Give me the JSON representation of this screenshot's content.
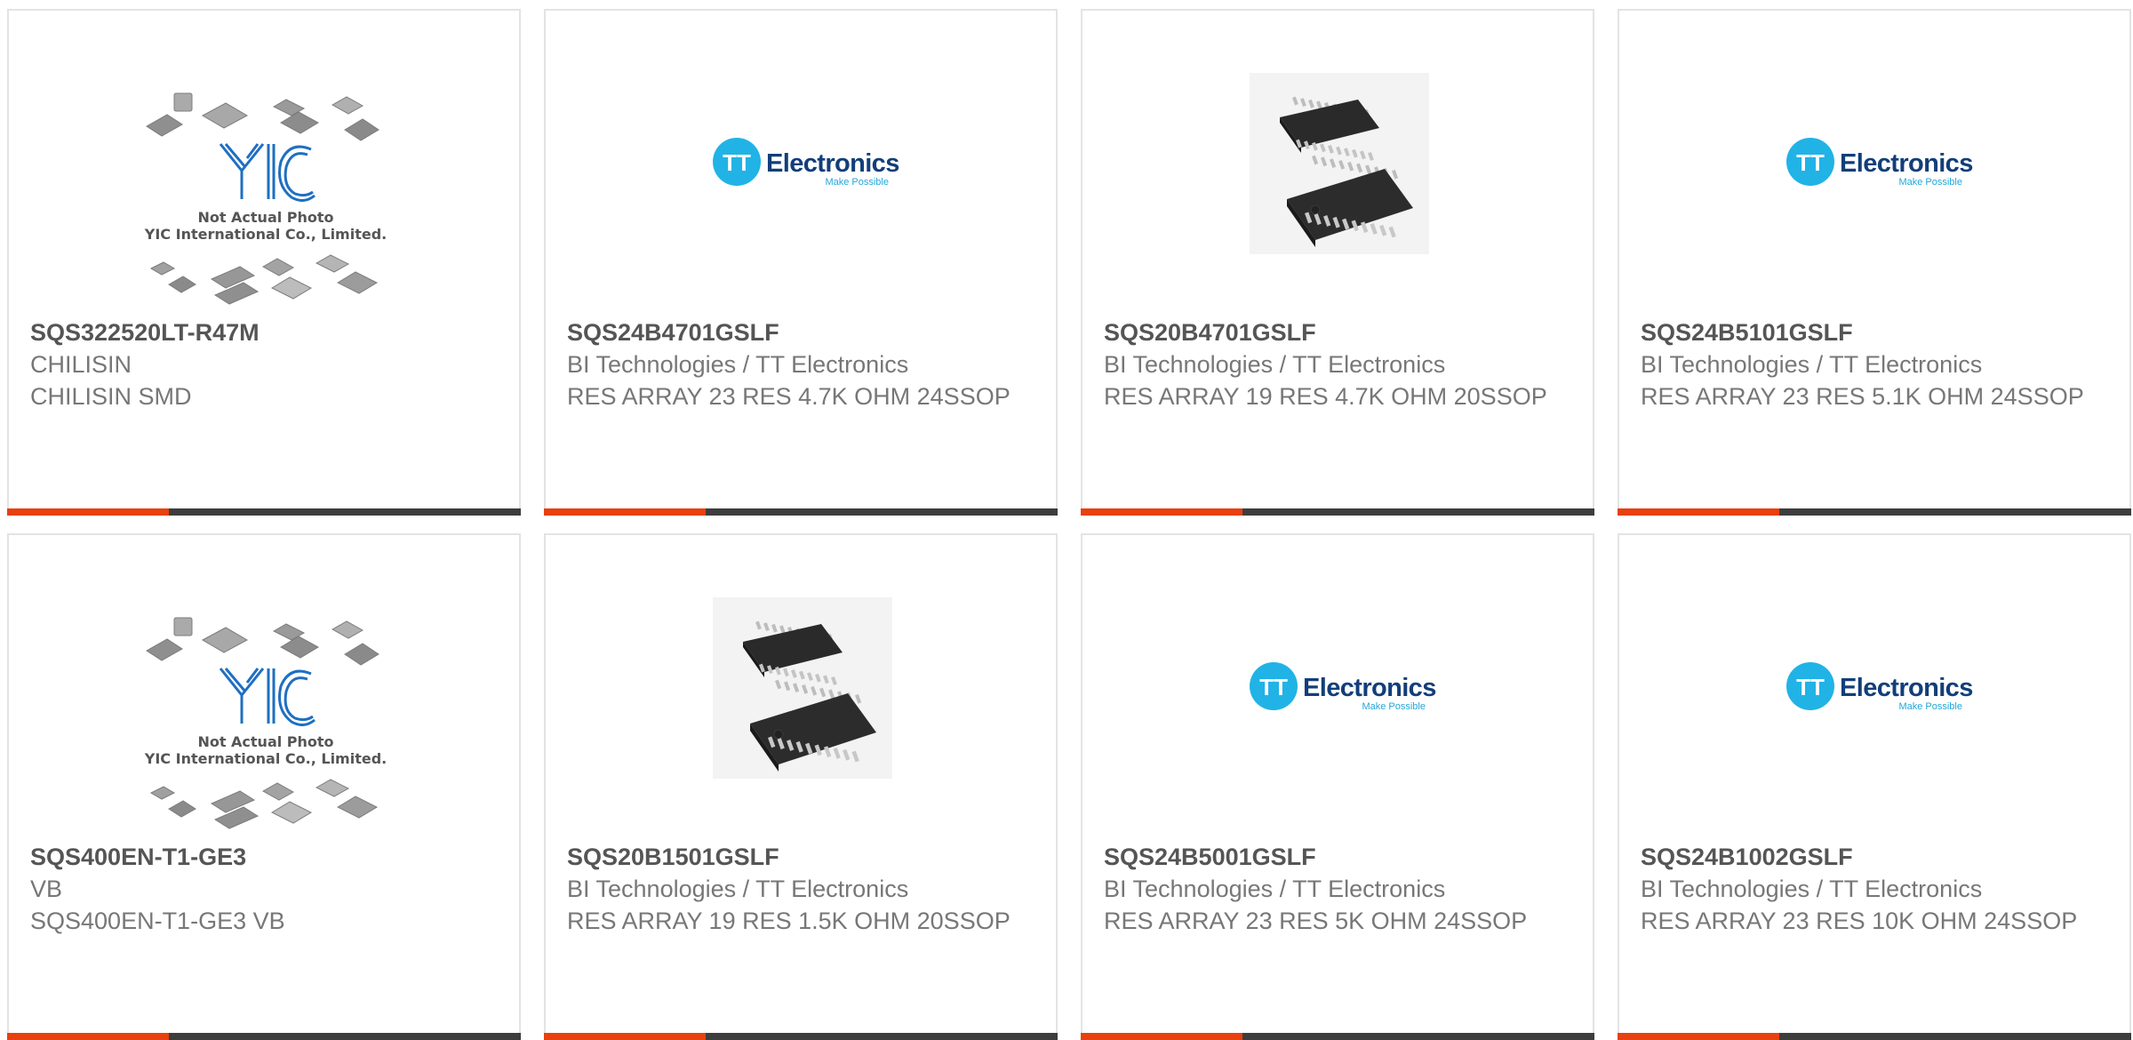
{
  "products": [
    {
      "part_number": "SQS322520LT-R47M",
      "manufacturer": "CHILISIN",
      "description": "CHILISIN SMD",
      "image": "yic-placeholder",
      "image_caption_1": "Not Actual Photo",
      "image_caption_2": "YIC International Co., Limited."
    },
    {
      "part_number": "SQS24B4701GSLF",
      "manufacturer": "BI Technologies / TT Electronics",
      "description": "RES ARRAY 23 RES 4.7K OHM 24SSOP",
      "image": "tt-electronics-logo",
      "logo_word": "Electronics",
      "logo_tag": "Make Possible"
    },
    {
      "part_number": "SQS20B4701GSLF",
      "manufacturer": "BI Technologies / TT Electronics",
      "description": "RES ARRAY 19 RES 4.7K OHM 20SSOP",
      "image": "ssop-chip-photo"
    },
    {
      "part_number": "SQS24B5101GSLF",
      "manufacturer": "BI Technologies / TT Electronics",
      "description": "RES ARRAY 23 RES 5.1K OHM 24SSOP",
      "image": "tt-electronics-logo",
      "logo_word": "Electronics",
      "logo_tag": "Make Possible"
    },
    {
      "part_number": "SQS400EN-T1-GE3",
      "manufacturer": "VB",
      "description": "SQS400EN-T1-GE3 VB",
      "image": "yic-placeholder",
      "image_caption_1": "Not Actual Photo",
      "image_caption_2": "YIC International Co., Limited."
    },
    {
      "part_number": "SQS20B1501GSLF",
      "manufacturer": "BI Technologies / TT Electronics",
      "description": "RES ARRAY 19 RES 1.5K OHM 20SSOP",
      "image": "ssop-chip-photo"
    },
    {
      "part_number": "SQS24B5001GSLF",
      "manufacturer": "BI Technologies / TT Electronics",
      "description": "RES ARRAY 23 RES 5K OHM 24SSOP",
      "image": "tt-electronics-logo",
      "logo_word": "Electronics",
      "logo_tag": "Make Possible"
    },
    {
      "part_number": "SQS24B1002GSLF",
      "manufacturer": "BI Technologies / TT Electronics",
      "description": "RES ARRAY 23 RES 10K OHM 24SSOP",
      "image": "tt-electronics-logo",
      "logo_word": "Electronics",
      "logo_tag": "Make Possible"
    }
  ],
  "colors": {
    "accent_bar": "#e8400e",
    "dark_bar": "#3d3d3d",
    "card_border": "#e3e3e3",
    "part_number_text": "#555555",
    "body_text": "#777777",
    "tt_circle": "#21b3e6",
    "tt_word": "#123e7a",
    "yic_blue": "#1e6fc2"
  }
}
